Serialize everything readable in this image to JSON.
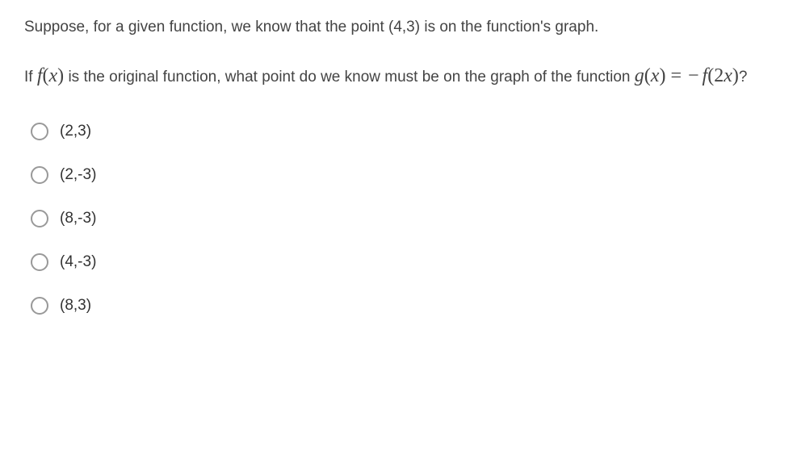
{
  "question": {
    "intro": "Suppose, for a given function, we know that the point (4,3) is on the function's graph.",
    "prompt_prefix": "If ",
    "fx": "f(x)",
    "prompt_middle": " is the original function, what point do we know must be on the graph of the function ",
    "gx": "g(x)",
    "equals": "=",
    "minus": "−",
    "f2x": "f(2x)",
    "prompt_suffix": "?"
  },
  "options": [
    {
      "label": "(2,3)"
    },
    {
      "label": "(2,-3)"
    },
    {
      "label": "(8,-3)"
    },
    {
      "label": "(4,-3)"
    },
    {
      "label": "(8,3)"
    }
  ]
}
